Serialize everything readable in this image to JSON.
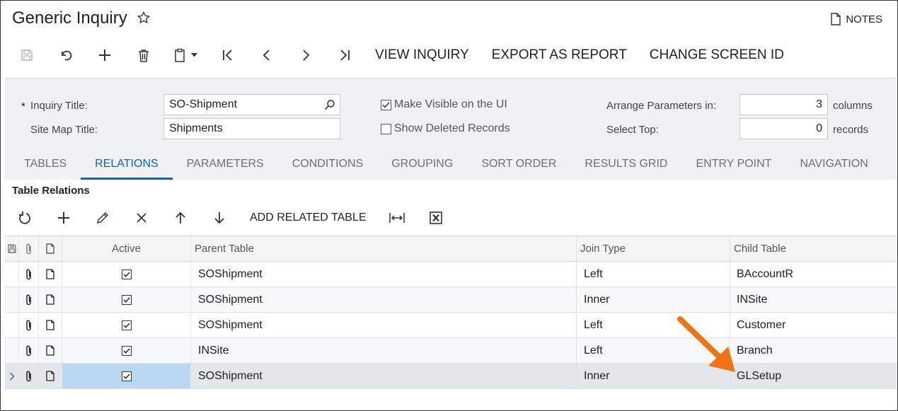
{
  "header": {
    "title": "Generic Inquiry",
    "notes_label": "NOTES"
  },
  "toolbar": {
    "buttons": [
      {
        "name": "save-button",
        "icon": "save-icon"
      },
      {
        "name": "undo-button",
        "icon": "undo-icon"
      },
      {
        "name": "add-button",
        "icon": "plus-icon"
      },
      {
        "name": "delete-button",
        "icon": "trash-icon"
      },
      {
        "name": "copy-paste-button",
        "icon": "clipboard-icon"
      },
      {
        "name": "first-button",
        "icon": "first-icon"
      },
      {
        "name": "prev-button",
        "icon": "chevron-left-icon"
      },
      {
        "name": "next-button",
        "icon": "chevron-right-icon"
      },
      {
        "name": "last-button",
        "icon": "last-icon"
      }
    ],
    "view_inquiry": "VIEW INQUIRY",
    "export_as_report": "EXPORT AS REPORT",
    "change_screen_id": "CHANGE SCREEN ID"
  },
  "form": {
    "required_mark": "*",
    "inquiry_title_label": "Inquiry Title:",
    "inquiry_title_value": "SO-Shipment",
    "site_map_title_label": "Site Map Title:",
    "site_map_title_value": "Shipments",
    "make_visible_label": "Make Visible on the UI",
    "make_visible_checked": true,
    "show_deleted_label": "Show Deleted Records",
    "show_deleted_checked": false,
    "arrange_label": "Arrange Parameters in:",
    "arrange_value": "3",
    "arrange_unit": "columns",
    "select_top_label": "Select Top:",
    "select_top_value": "0",
    "select_top_unit": "records"
  },
  "tabs": [
    {
      "label": "TABLES",
      "active": false
    },
    {
      "label": "RELATIONS",
      "active": true
    },
    {
      "label": "PARAMETERS",
      "active": false
    },
    {
      "label": "CONDITIONS",
      "active": false
    },
    {
      "label": "GROUPING",
      "active": false
    },
    {
      "label": "SORT ORDER",
      "active": false
    },
    {
      "label": "RESULTS GRID",
      "active": false
    },
    {
      "label": "ENTRY POINT",
      "active": false
    },
    {
      "label": "NAVIGATION",
      "active": false
    }
  ],
  "relations": {
    "section_title": "Table Relations",
    "add_related_table": "ADD RELATED TABLE",
    "columns": {
      "active": "Active",
      "parent_table": "Parent Table",
      "join_type": "Join Type",
      "child_table": "Child Table"
    },
    "rows": [
      {
        "active": true,
        "parent": "SOShipment",
        "join": "Left",
        "child": "BAccountR"
      },
      {
        "active": true,
        "parent": "SOShipment",
        "join": "Inner",
        "child": "INSite"
      },
      {
        "active": true,
        "parent": "SOShipment",
        "join": "Left",
        "child": "Customer"
      },
      {
        "active": true,
        "parent": "INSite",
        "join": "Left",
        "child": "Branch"
      },
      {
        "active": true,
        "parent": "SOShipment",
        "join": "Inner",
        "child": "GLSetup"
      }
    ]
  },
  "colors": {
    "accent": "#0b63c7",
    "arrow": "#f07415",
    "selected_cell": "#b9d7f0"
  }
}
